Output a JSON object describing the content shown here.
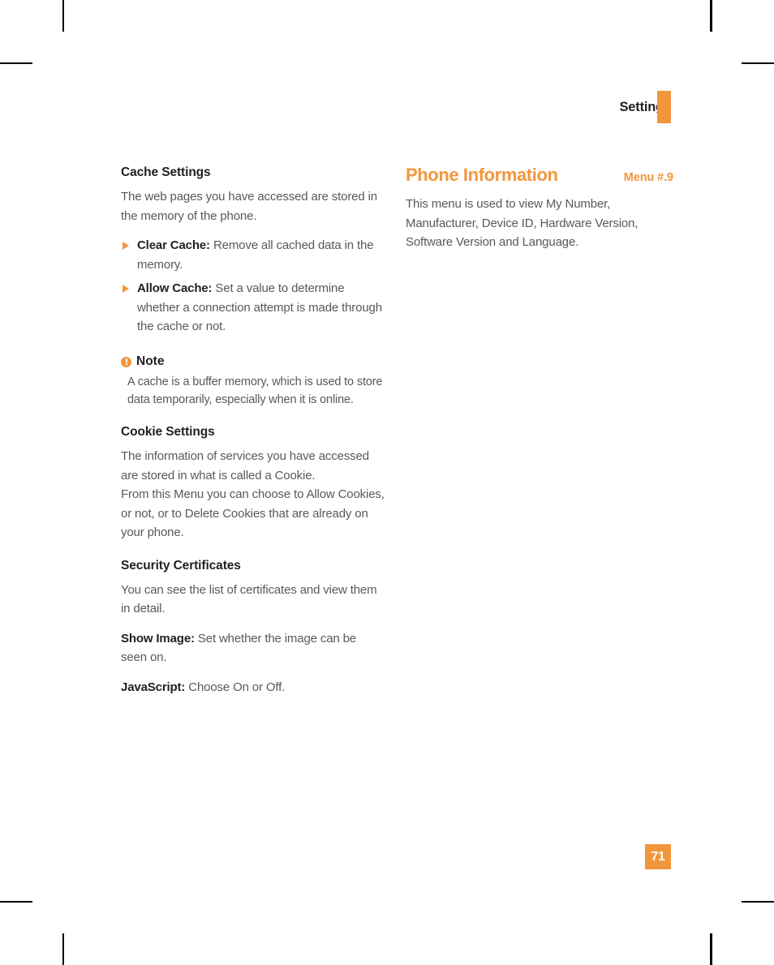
{
  "page": {
    "running_head": "Settings",
    "folio": "71"
  },
  "left_column": {
    "sections": [
      {
        "heading": "Cache Settings",
        "intro": "The web pages you have accessed are stored in the memory of the phone.",
        "bullets": [
          {
            "lead": "Clear Cache:",
            "text": "Remove all cached data in the memory."
          },
          {
            "lead": "Allow Cache:",
            "text": "Set a value to determine whether a connection attempt is made through the cache or not."
          }
        ]
      }
    ],
    "note": {
      "icon": "exclamation-circle-icon",
      "title": "Note",
      "body": "A cache is a buffer memory, which is used to store data temporarily, especially when it is online."
    },
    "cookie_settings": {
      "heading": "Cookie Settings",
      "paragraph_1": "The information of services you have accessed are stored in what is called a Cookie.",
      "paragraph_2": "From this Menu you can choose to Allow Cookies, or not, or to Delete Cookies that are already on your phone."
    },
    "security_certificates": {
      "heading": "Security Certificates",
      "paragraph": "You can see the list of certificates and view them in detail.",
      "show_image_lead": "Show Image:",
      "show_image_text": "Set whether the image can be seen on.",
      "javascript_lead": "JavaScript:",
      "javascript_text": "Choose On or Off."
    }
  },
  "right_column": {
    "menu_title": "Phone Information",
    "menu_number": "Menu #.9",
    "paragraph": "This menu is used to view My Number, Manufacturer, Device ID, Hardware Version, Software Version and Language."
  },
  "colors": {
    "accent": "#F2963C",
    "heading_dark": "#231f20",
    "body_gray": "#58595b"
  }
}
